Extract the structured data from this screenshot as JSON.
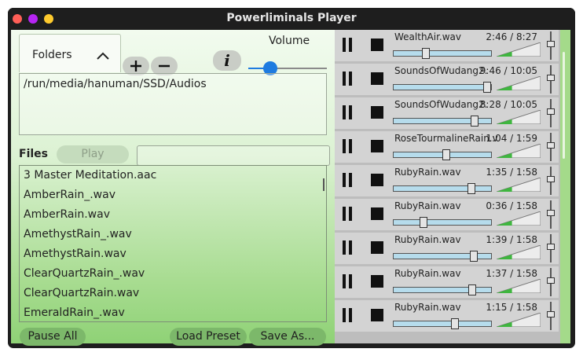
{
  "window": {
    "title": "Powerliminals Player",
    "colors": {
      "close": "#ff5f57",
      "minimize": "#b625f2",
      "zoom": "#fecb2e"
    }
  },
  "left": {
    "folders_tab_label": "Folders",
    "volume_label": "Volume",
    "volume_level": 0.28,
    "folder_path": "/run/media/hanuman/SSD/Audios",
    "files_label": "Files",
    "play_label": "Play",
    "search_value": "",
    "files": [
      "3 Master Meditation.aac",
      "AmberRain_.wav",
      "AmberRain.wav",
      "AmethystRain_.wav",
      "AmethystRain.wav",
      "ClearQuartzRain_.wav",
      "ClearQuartzRain.wav",
      "EmeraldRain_.wav"
    ],
    "pause_all_label": "Pause All",
    "load_preset_label": "Load Preset",
    "save_as_label": "Save As..."
  },
  "tracks": [
    {
      "name": "WealthAir.wav",
      "time": "2:46 / 8:27",
      "progress": 0.33,
      "volume": 0.35
    },
    {
      "name": "SoundsOfWudang2.",
      "time": "9:46 / 10:05",
      "progress": 0.96,
      "volume": 0.35
    },
    {
      "name": "SoundsOfWudang2.",
      "time": "8:28 / 10:05",
      "progress": 0.83,
      "volume": 0.35
    },
    {
      "name": "RoseTourmalineRain.v",
      "time": "1:04 / 1:59",
      "progress": 0.54,
      "volume": 0.35
    },
    {
      "name": "RubyRain.wav",
      "time": "1:35 / 1:58",
      "progress": 0.8,
      "volume": 0.35
    },
    {
      "name": "RubyRain.wav",
      "time": "0:36 / 1:58",
      "progress": 0.31,
      "volume": 0.35
    },
    {
      "name": "RubyRain.wav",
      "time": "1:39 / 1:58",
      "progress": 0.82,
      "volume": 0.35
    },
    {
      "name": "RubyRain.wav",
      "time": "1:37 / 1:58",
      "progress": 0.81,
      "volume": 0.35
    },
    {
      "name": "RubyRain.wav",
      "time": "1:15 / 1:58",
      "progress": 0.63,
      "volume": 0.35
    }
  ]
}
